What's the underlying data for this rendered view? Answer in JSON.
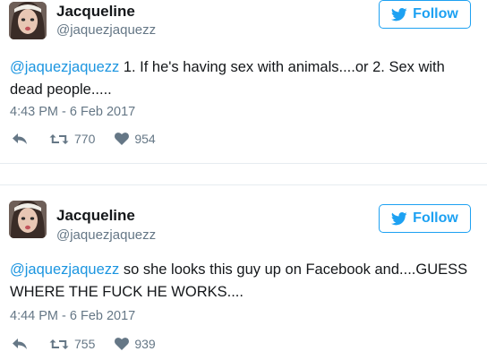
{
  "tweets": [
    {
      "author_name": "Jacqueline",
      "handle": "@jaquezjaquezz",
      "follow_label": "Follow",
      "mention": "@jaquezjaquezz",
      "body": " 1. If he's having sex with animals....or 2. Sex with dead people.....",
      "timestamp": "4:43 PM - 6 Feb 2017",
      "retweets": "770",
      "likes": "954"
    },
    {
      "author_name": "Jacqueline",
      "handle": "@jaquezjaquezz",
      "follow_label": "Follow",
      "mention": "@jaquezjaquezz",
      "body": " so she looks this guy up on Facebook and....GUESS WHERE THE FUCK HE WORKS....",
      "timestamp": "4:44 PM - 6 Feb 2017",
      "retweets": "755",
      "likes": "939"
    }
  ],
  "colors": {
    "accent": "#1da1f2",
    "mention": "#1b95e0",
    "muted": "#657786",
    "text": "#14171a",
    "divider": "#e6ecf0"
  },
  "icons": {
    "follow": "bird-icon",
    "reply": "reply-icon",
    "retweet": "retweet-icon",
    "like": "heart-icon"
  }
}
